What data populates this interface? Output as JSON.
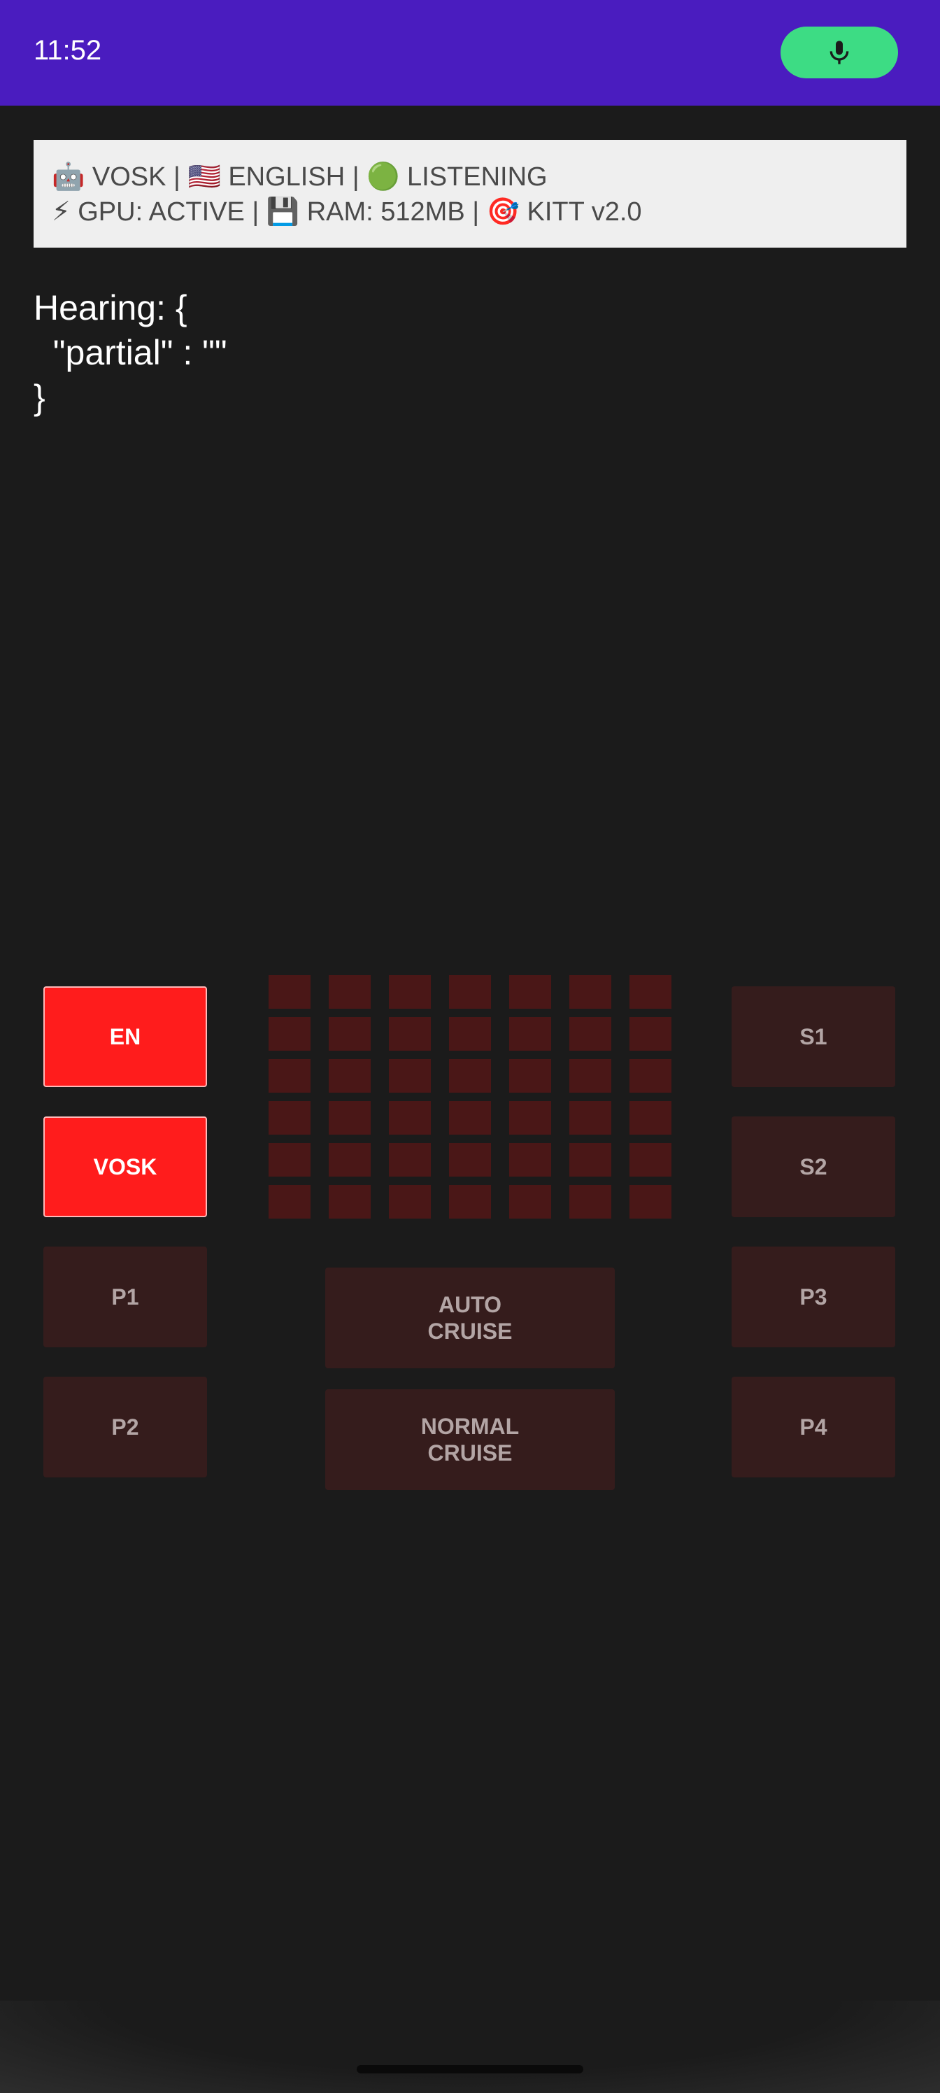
{
  "status_bar": {
    "time": "11:52",
    "mic_icon": "microphone-icon",
    "accent_color": "#4a1cbf",
    "mic_color": "#3ddc84"
  },
  "info_banner": {
    "line1": "🤖 VOSK | 🇺🇸 ENGLISH | 🟢 LISTENING",
    "line2": "⚡ GPU: ACTIVE | 💾 RAM: 512MB | 🎯 KITT v2.0"
  },
  "hearing": {
    "text": "Hearing: {\n  \"partial\" : \"\"\n}"
  },
  "left_buttons": {
    "en": "EN",
    "vosk": "VOSK",
    "p1": "P1",
    "p2": "P2"
  },
  "right_buttons": {
    "s1": "S1",
    "s2": "S2",
    "p3": "P3",
    "p4": "P4"
  },
  "center_buttons": {
    "auto_cruise": "AUTO\nCRUISE",
    "normal_cruise": "NORMAL\nCRUISE"
  },
  "colors": {
    "active_button": "#ff1c1c",
    "inactive_button": "#351c1c",
    "grid_cell": "#4a1717",
    "background": "#1b1b1b"
  },
  "voice_meter": {
    "columns": 7,
    "rows": 6
  }
}
